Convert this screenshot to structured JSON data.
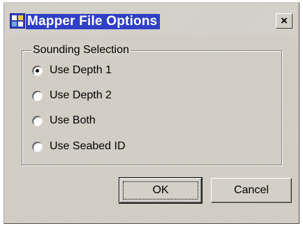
{
  "window": {
    "title": "Mapper File Options",
    "close_symbol": "×"
  },
  "group": {
    "legend": "Sounding Selection",
    "options": [
      {
        "label": "Use Depth 1",
        "selected": true
      },
      {
        "label": "Use Depth 2",
        "selected": false
      },
      {
        "label": "Use Both",
        "selected": false
      },
      {
        "label": "Use Seabed ID",
        "selected": false
      }
    ]
  },
  "buttons": {
    "ok": "OK",
    "cancel": "Cancel"
  },
  "colors": {
    "titlebar_highlight": "#2f3fc7",
    "dialog_bg": "#d4d0c8"
  }
}
